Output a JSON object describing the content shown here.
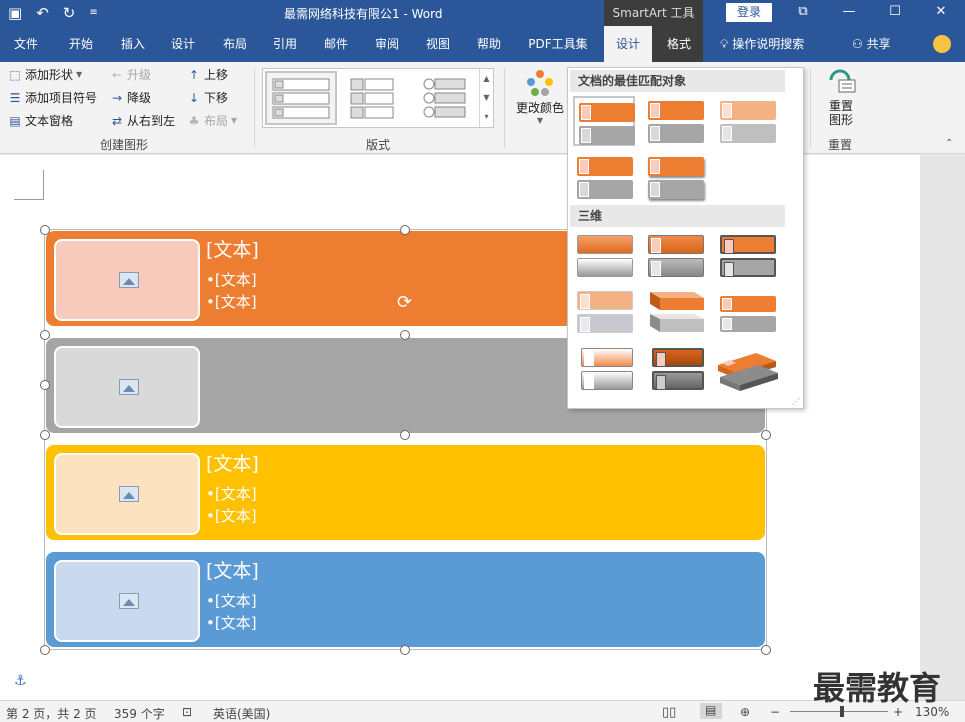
{
  "titlebar": {
    "title": "最需网络科技有限公1  -  Word",
    "context_tab_title": "SmartArt 工具",
    "login": "登录",
    "qat": {
      "save_icon": "save-icon",
      "undo_icon": "undo-icon",
      "redo_icon": "redo-icon",
      "customize_icon": "customize-icon"
    },
    "controls": {
      "ribbon_display": "⧉",
      "minimize": "—",
      "maximize": "☐",
      "close": "✕"
    }
  },
  "tabs": [
    {
      "label": "文件",
      "active": false
    },
    {
      "label": "开始",
      "active": false
    },
    {
      "label": "插入",
      "active": false
    },
    {
      "label": "设计",
      "active": false
    },
    {
      "label": "布局",
      "active": false
    },
    {
      "label": "引用",
      "active": false
    },
    {
      "label": "邮件",
      "active": false
    },
    {
      "label": "审阅",
      "active": false
    },
    {
      "label": "视图",
      "active": false
    },
    {
      "label": "帮助",
      "active": false
    },
    {
      "label": "PDF工具集",
      "active": false
    },
    {
      "label": "设计",
      "active": true
    },
    {
      "label": "格式",
      "active": false
    }
  ],
  "search_tab": "操作说明搜索",
  "share": "共享",
  "ribbon": {
    "create_graphic": {
      "add_shape": "添加形状",
      "add_bullet": "添加项目符号",
      "text_pane": "文本窗格",
      "promote": "升级",
      "demote": "降级",
      "right_to_left": "从右到左",
      "move_up": "上移",
      "move_down": "下移",
      "layout": "布局",
      "label": "创建图形"
    },
    "layouts_label": "版式",
    "change_colors": "更改颜色",
    "reset_graphic": "重置\n图形",
    "reset_graphic_line1": "重置",
    "reset_graphic_line2": "图形",
    "reset_label": "重置"
  },
  "smartart": {
    "rows": [
      {
        "color": "#ed7d31",
        "pic_color": "#f8cbbd",
        "title": "[文本]",
        "bullets": [
          "•[文本]",
          "•[文本]"
        ]
      },
      {
        "color": "#a5a5a5",
        "pic_color": "#d9d9d9",
        "title": "",
        "bullets": []
      },
      {
        "color": "#ffc000",
        "pic_color": "#fde2c0",
        "title": "[文本]",
        "bullets": [
          "•[文本]",
          "•[文本]"
        ]
      },
      {
        "color": "#5b9bd5",
        "pic_color": "#c9d9ee",
        "title": "[文本]",
        "bullets": [
          "•[文本]",
          "•[文本]"
        ]
      }
    ]
  },
  "styles_gallery": {
    "section_best_match": "文档的最佳匹配对象",
    "section_3d": "三维"
  },
  "statusbar": {
    "page": "第 2 页，共 2 页",
    "words": "359 个字",
    "language": "英语(美国)",
    "zoom": "130%",
    "zoom_minus": "−",
    "zoom_plus": "+"
  },
  "watermark": "最需教育",
  "colors": {
    "title_bar": "#2b579a",
    "context_tab": "#3d3d3d",
    "orange": "#ed7d31",
    "gray": "#a5a5a5",
    "yellow": "#ffc000",
    "blue": "#5b9bd5"
  }
}
